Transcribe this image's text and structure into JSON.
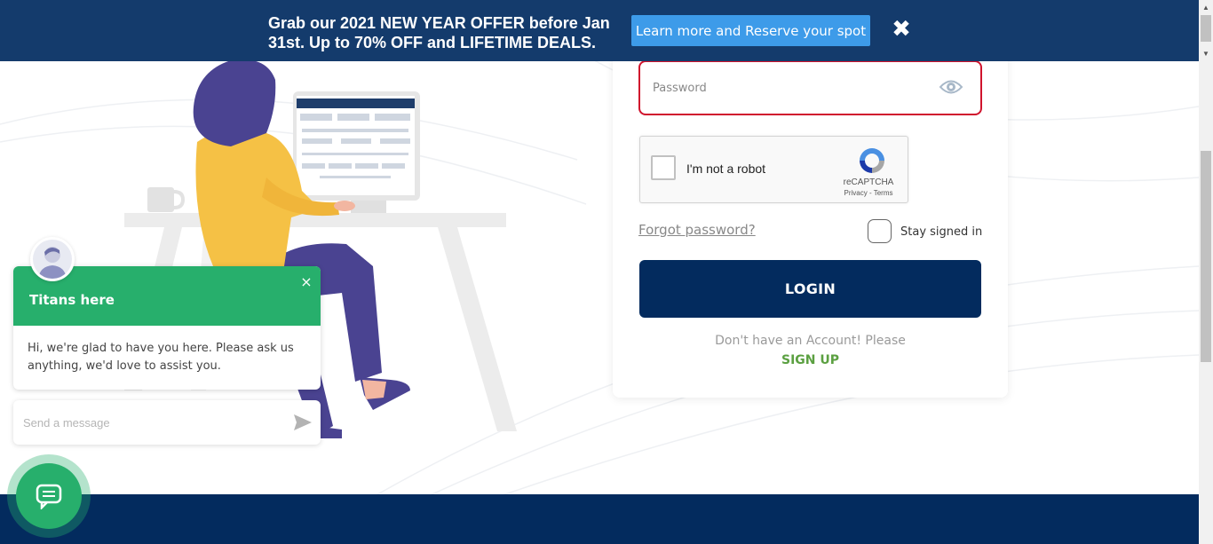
{
  "banner": {
    "text": "Grab our 2021 NEW YEAR OFFER before Jan 31st. Up to 70% OFF and LIFETIME DEALS.",
    "button_label": "Learn more and Reserve your spot",
    "close_glyph": "✖"
  },
  "login": {
    "password_placeholder": "Password",
    "captcha": {
      "label": "I'm not a robot",
      "brand": "reCAPTCHA",
      "links": "Privacy - Terms"
    },
    "forgot_label": "Forgot password?",
    "stay_signed_in_label": "Stay signed in",
    "login_button_label": "LOGIN",
    "no_account_text": "Don't have an Account! Please",
    "signup_label": "SIGN UP"
  },
  "chat": {
    "title": "Titans here",
    "close_glyph": "×",
    "message": "Hi, we're glad to have you here. Please ask us anything, we'd love to assist you.",
    "input_placeholder": "Send a message"
  },
  "colors": {
    "banner_bg": "#143b6c",
    "banner_button": "#3d9be9",
    "primary_navy": "#032b5e",
    "error_red": "#d0132d",
    "signup_green": "#5ba041",
    "chat_green": "#27af6c"
  },
  "icons": {
    "banner_close": "close-icon",
    "password_toggle": "eye-icon",
    "captcha_logo": "recaptcha-icon",
    "chat_send": "send-icon",
    "chat_launcher": "chat-bubble-icon",
    "chat_avatar": "avatar"
  }
}
